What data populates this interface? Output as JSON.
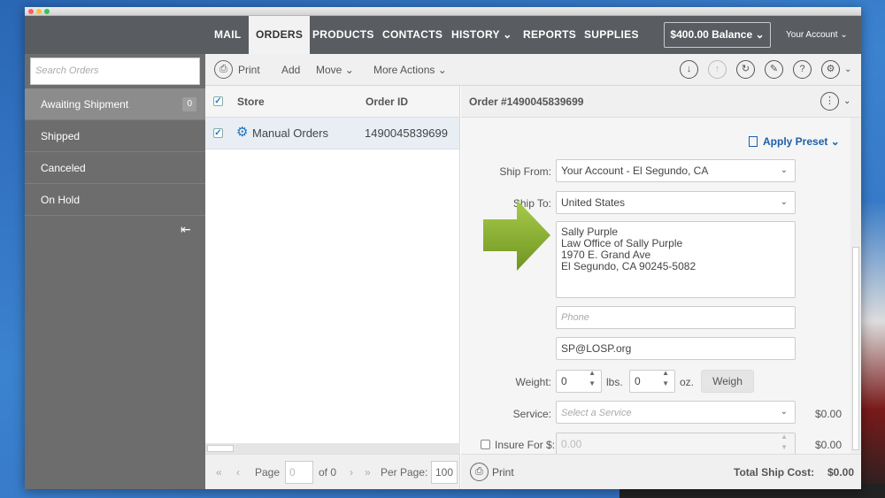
{
  "nav": {
    "items": [
      "MAIL",
      "ORDERS",
      "PRODUCTS",
      "CONTACTS",
      "HISTORY",
      "REPORTS",
      "SUPPLIES"
    ],
    "active": "ORDERS",
    "balance": "$400.00 Balance",
    "account": "Your Account"
  },
  "sidebar": {
    "search_placeholder": "Search Orders",
    "items": [
      {
        "label": "Awaiting Shipment",
        "count": "0"
      },
      {
        "label": "Shipped"
      },
      {
        "label": "Canceled"
      },
      {
        "label": "On Hold"
      }
    ]
  },
  "toolbar": {
    "print": "Print",
    "add": "Add",
    "move": "Move",
    "more": "More Actions"
  },
  "list": {
    "col_store": "Store",
    "col_order": "Order ID",
    "rows": [
      {
        "store": "Manual Orders",
        "order_id": "1490045839699"
      }
    ]
  },
  "pager": {
    "page_label": "Page",
    "page_value": "0",
    "of": "of 0",
    "per_page_label": "Per Page:",
    "per_page_value": "100"
  },
  "detail": {
    "title": "Order #1490045839699",
    "apply_preset": "Apply Preset",
    "ship_from_label": "Ship From:",
    "ship_from_value": "Your Account - El Segundo, CA",
    "ship_to_label": "Ship To:",
    "ship_to_value": "United States",
    "address_lines": [
      "Sally Purple",
      "Law Office of Sally Purple",
      "1970 E. Grand Ave",
      "El Segundo, CA 90245-5082"
    ],
    "phone_placeholder": "Phone",
    "email_value": "SP@LOSP.org",
    "weight_label": "Weight:",
    "lbs_value": "0",
    "lbs_unit": "lbs.",
    "oz_value": "0",
    "oz_unit": "oz.",
    "weigh_button": "Weigh",
    "service_label": "Service:",
    "service_placeholder": "Select a Service",
    "service_price": "$0.00",
    "insure_label": "Insure For $:",
    "insure_placeholder": "0.00",
    "insure_price": "$0.00",
    "print": "Print",
    "total_label": "Total Ship Cost:",
    "total_value": "$0.00"
  },
  "colors": {
    "nav_bg": "#595d61",
    "sidebar_bg": "#6d6d6d",
    "link": "#1e5fa8",
    "arrow": "#8db33a"
  }
}
